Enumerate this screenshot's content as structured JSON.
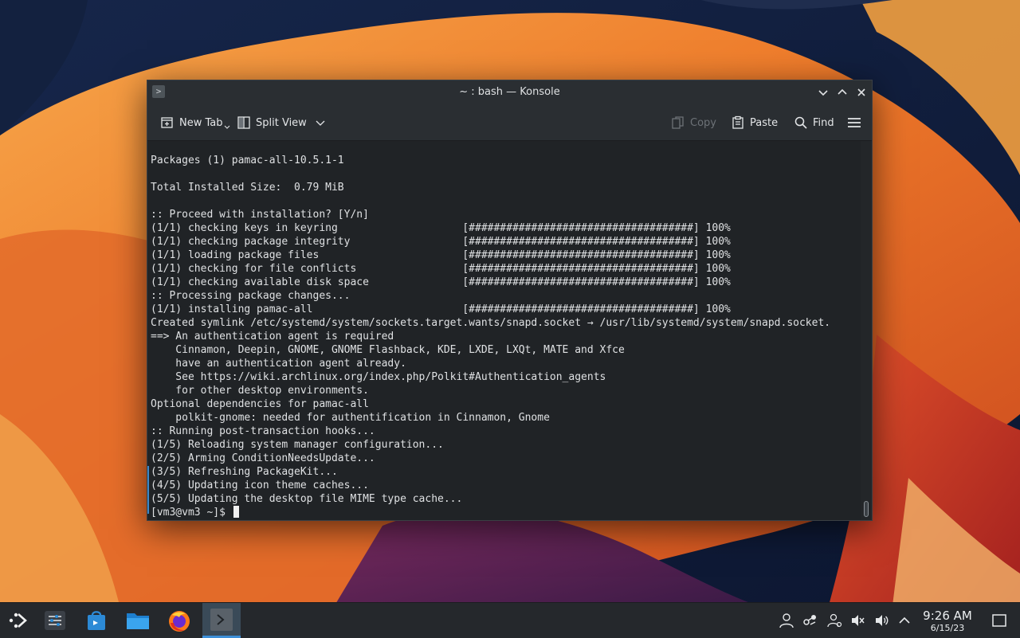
{
  "window": {
    "title": "~ : bash — Konsole"
  },
  "toolbar": {
    "new_tab": "New Tab",
    "split_view": "Split View",
    "copy": "Copy",
    "paste": "Paste",
    "find": "Find"
  },
  "terminal": {
    "lines": [
      "Packages (1) pamac-all-10.5.1-1",
      "",
      "Total Installed Size:  0.79 MiB",
      "",
      ":: Proceed with installation? [Y/n]",
      "(1/1) checking keys in keyring                    [####################################] 100%",
      "(1/1) checking package integrity                  [####################################] 100%",
      "(1/1) loading package files                       [####################################] 100%",
      "(1/1) checking for file conflicts                 [####################################] 100%",
      "(1/1) checking available disk space               [####################################] 100%",
      ":: Processing package changes...",
      "(1/1) installing pamac-all                        [####################################] 100%",
      "Created symlink /etc/systemd/system/sockets.target.wants/snapd.socket → /usr/lib/systemd/system/snapd.socket.",
      "==> An authentication agent is required",
      "    Cinnamon, Deepin, GNOME, GNOME Flashback, KDE, LXDE, LXQt, MATE and Xfce",
      "    have an authentication agent already.",
      "    See https://wiki.archlinux.org/index.php/Polkit#Authentication_agents",
      "    for other desktop environments.",
      "Optional dependencies for pamac-all",
      "    polkit-gnome: needed for authentification in Cinnamon, Gnome",
      ":: Running post-transaction hooks...",
      "(1/5) Reloading system manager configuration...",
      "(2/5) Arming ConditionNeedsUpdate...",
      "(3/5) Refreshing PackageKit...",
      "(4/5) Updating icon theme caches...",
      "(5/5) Updating the desktop file MIME type cache..."
    ],
    "prompt": "[vm3@vm3 ~]$ "
  },
  "taskbar": {
    "apps": [
      "application-launcher",
      "system-settings",
      "discover",
      "dolphin-files",
      "firefox",
      "konsole"
    ],
    "clock_time": "9:26 AM",
    "clock_date": "6/15/23"
  },
  "colors": {
    "accent": "#3d8fd8",
    "terminal_bg": "#202326",
    "window_chrome": "#2a2e32"
  }
}
